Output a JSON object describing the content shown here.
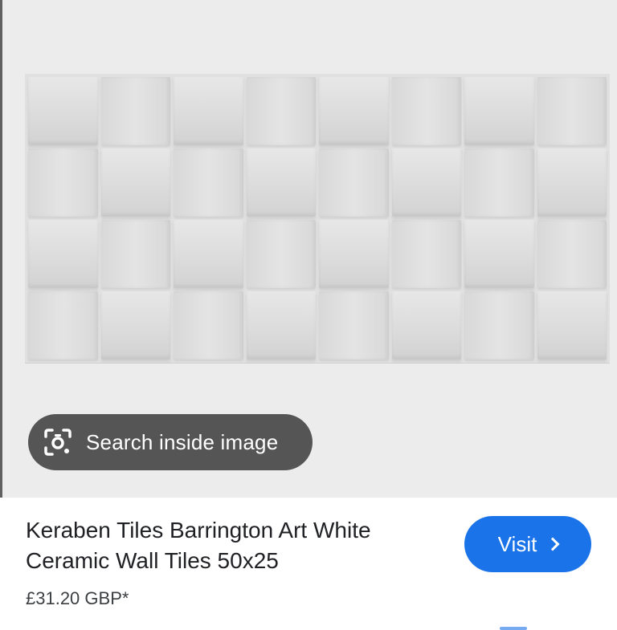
{
  "image_preview": {
    "alt_icon": "tile-image",
    "tile_rows": 4,
    "tile_columns": 8
  },
  "search_inside": {
    "label": "Search inside image",
    "icon": "lens-camera-icon"
  },
  "result": {
    "title": "Keraben Tiles Barrington Art White Ceramic Wall Tiles 50x25",
    "price": "£31.20 GBP*",
    "visit_label": "Visit",
    "visit_icon": "chevron-right-icon"
  },
  "colors": {
    "accent": "#1a73e8",
    "pill_background": "#555555"
  }
}
